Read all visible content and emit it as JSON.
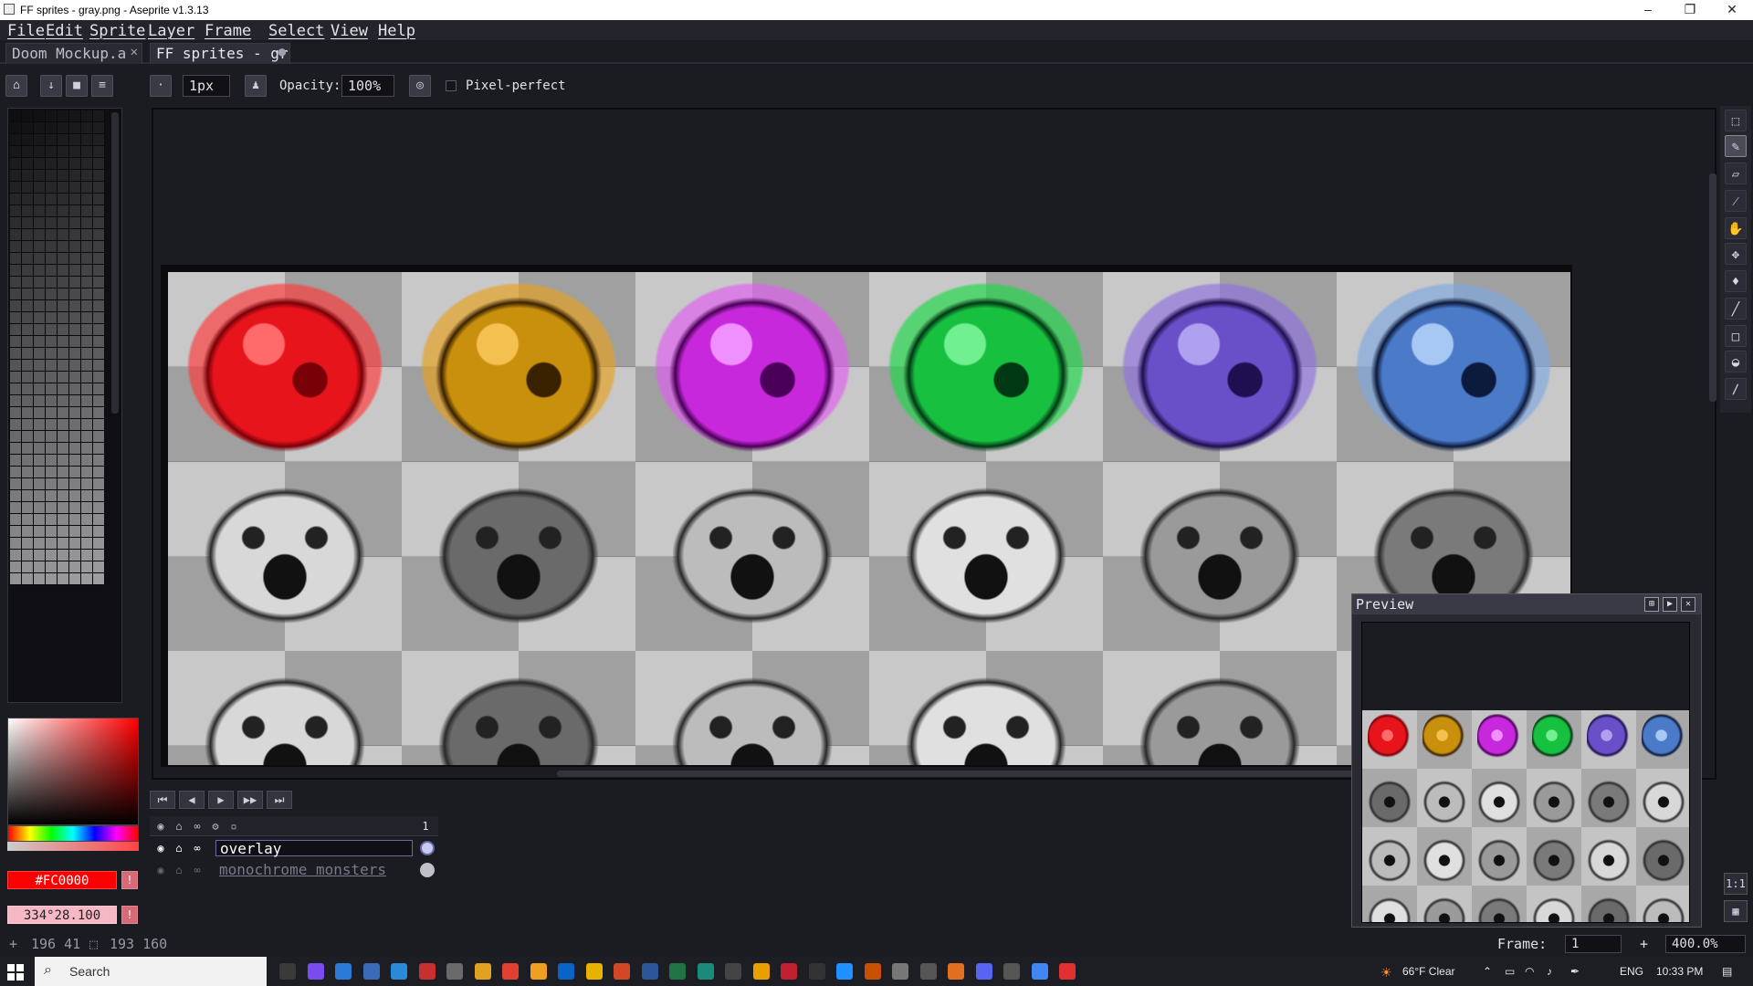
{
  "window": {
    "title": "FF sprites - gray.png - Aseprite v1.3.13",
    "minimize": "–",
    "restore": "❐",
    "close": "✕"
  },
  "menu": {
    "items": [
      "File",
      "Edit",
      "Sprite",
      "Layer",
      "Frame",
      "Select",
      "View",
      "Help"
    ]
  },
  "tabs": [
    {
      "label": "Doom Mockup.a",
      "close": "✕"
    },
    {
      "label": "FF sprites - gr",
      "modified": "●"
    }
  ],
  "tool_options": {
    "brush_size": "1px",
    "opacity_label": "Opacity:",
    "opacity_value": "100%",
    "pixel_perfect_label": "Pixel-perfect"
  },
  "colors": {
    "foreground": "#fc0000",
    "foreground_label": "#FC0000",
    "background": "#f7b8c6",
    "background_label": "334°28.100",
    "accent": "#5a5aa0"
  },
  "timeline": {
    "frame_number": "1",
    "layers": [
      {
        "name": "overlay",
        "active": true
      },
      {
        "name": "monochrome monsters",
        "active": false
      }
    ]
  },
  "preview": {
    "title": "Preview"
  },
  "status": {
    "cursor": "196  41",
    "selection_size": "193  160",
    "frame_label": "Frame:",
    "frame_value": "1",
    "zoom": "400.0%"
  },
  "taskbar": {
    "search_placeholder": "Search",
    "weather": "66°F  Clear",
    "language": "ENG",
    "time": "10:33 PM"
  },
  "sprites": {
    "row1": [
      {
        "color": "#e8141c",
        "light": "#ff6a6a",
        "dark": "#7a0008",
        "glow": "#ff3a3a"
      },
      {
        "color": "#c8900c",
        "light": "#f4c050",
        "dark": "#3a2200",
        "glow": "#e6a020"
      },
      {
        "color": "#c828dc",
        "light": "#f090ff",
        "dark": "#4a0058",
        "glow": "#e060f0"
      },
      {
        "color": "#18c040",
        "light": "#70f090",
        "dark": "#003814",
        "glow": "#20d848"
      },
      {
        "color": "#6a50c8",
        "light": "#b0a0f0",
        "dark": "#1e1050",
        "glow": "#9070e0"
      },
      {
        "color": "#4a7ac8",
        "light": "#a8c8f4",
        "dark": "#0c1a3c",
        "glow": "#80a8e0"
      }
    ],
    "row2_tones": [
      "#d8d8d8",
      "#6a6a6a",
      "#bcbcbc",
      "#e0e0e0",
      "#9a9a9a",
      "#7a7a7a"
    ]
  }
}
